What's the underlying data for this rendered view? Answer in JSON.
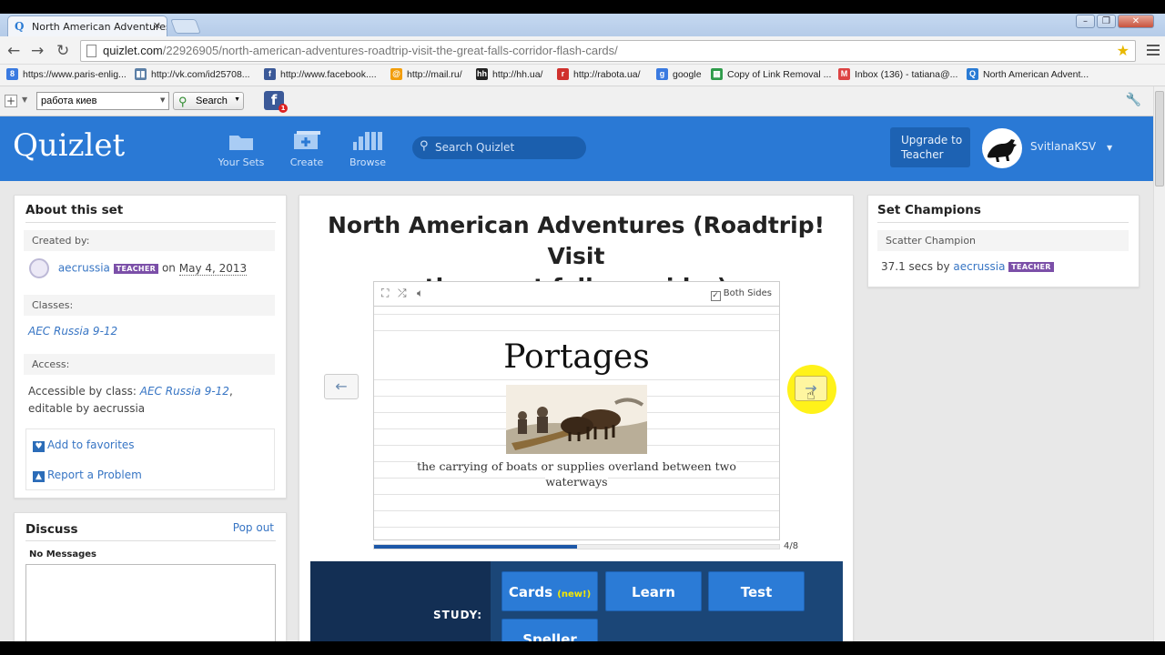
{
  "browser": {
    "tab_title": "North American Adventures |",
    "url_host": "quizlet.com",
    "url_path": "/22926905/north-american-adventures-roadtrip-visit-the-great-falls-corridor-flash-cards/",
    "bookmarks": [
      {
        "label": "https://www.paris-enlig...",
        "icon": "g-icon",
        "color": "#3a7ae0",
        "glyph": "8"
      },
      {
        "label": "http://vk.com/id25708...",
        "icon": "vk-icon",
        "color": "#5b7fa6",
        "glyph": "▮▮"
      },
      {
        "label": "http://www.facebook....",
        "icon": "facebook-icon",
        "color": "#3b5998",
        "glyph": "f"
      },
      {
        "label": "http://mail.ru/",
        "icon": "mailru-icon",
        "color": "#f29d0a",
        "glyph": "@"
      },
      {
        "label": "http://hh.ua/",
        "icon": "hh-icon",
        "color": "#222",
        "glyph": "hh"
      },
      {
        "label": "http://rabota.ua/",
        "icon": "rabota-icon",
        "color": "#d0312d",
        "glyph": "r"
      },
      {
        "label": "google",
        "icon": "google-icon",
        "color": "#3a7ae0",
        "glyph": "g"
      },
      {
        "label": "Copy of Link Removal ...",
        "icon": "sheets-icon",
        "color": "#2e9b4a",
        "glyph": "▦"
      },
      {
        "label": "Inbox (136) - tatiana@...",
        "icon": "gmail-icon",
        "color": "#d44",
        "glyph": "M"
      },
      {
        "label": "North American Advent...",
        "icon": "quizlet-icon",
        "color": "#2a7bd4",
        "glyph": "Q"
      }
    ],
    "addon_search_value": "работа киев",
    "addon_search_button": "Search"
  },
  "header": {
    "logo": "Quizlet",
    "nav": [
      {
        "label": "Your Sets",
        "icon": "folder-icon"
      },
      {
        "label": "Create",
        "icon": "create-icon"
      },
      {
        "label": "Browse",
        "icon": "browse-icon"
      }
    ],
    "search_placeholder": "Search Quizlet",
    "upgrade_line1": "Upgrade to",
    "upgrade_line2": "Teacher",
    "username": "SvitlanaKSV"
  },
  "about": {
    "title": "About this set",
    "created_by_label": "Created by:",
    "creator": "aecrussia",
    "creator_badge": "TEACHER",
    "on_text": "on",
    "date": "May 4, 2013",
    "classes_label": "Classes:",
    "class_name": "AEC Russia 9-12",
    "access_label": "Access:",
    "access_text_1": "Accessible by class:",
    "access_class": "AEC Russia 9-12",
    "access_text_2": "editable by aecrussia",
    "add_favorites": "Add to favorites",
    "report_problem": "Report a Problem"
  },
  "discuss": {
    "title": "Discuss",
    "pop_out": "Pop out",
    "no_messages": "No Messages"
  },
  "set": {
    "title_line1": "North American Adventures (Roadtrip! Visit",
    "title_line2": "the great falls corridor)",
    "both_sides": "Both Sides",
    "term": "Portages",
    "definition_line1": "the carrying of boats or supplies overland between two",
    "definition_line2": "waterways",
    "progress_text": "4/8",
    "progress_fraction": 0.5,
    "prev_arrow": "←",
    "next_arrow": "→"
  },
  "study": {
    "label": "STUDY:",
    "cards": "Cards",
    "cards_new": "(new!)",
    "learn": "Learn",
    "test": "Test",
    "speller": "Speller"
  },
  "champions": {
    "title": "Set Champions",
    "scatter_label": "Scatter Champion",
    "time": "37.1 secs by",
    "user": "aecrussia",
    "badge": "TEACHER"
  }
}
